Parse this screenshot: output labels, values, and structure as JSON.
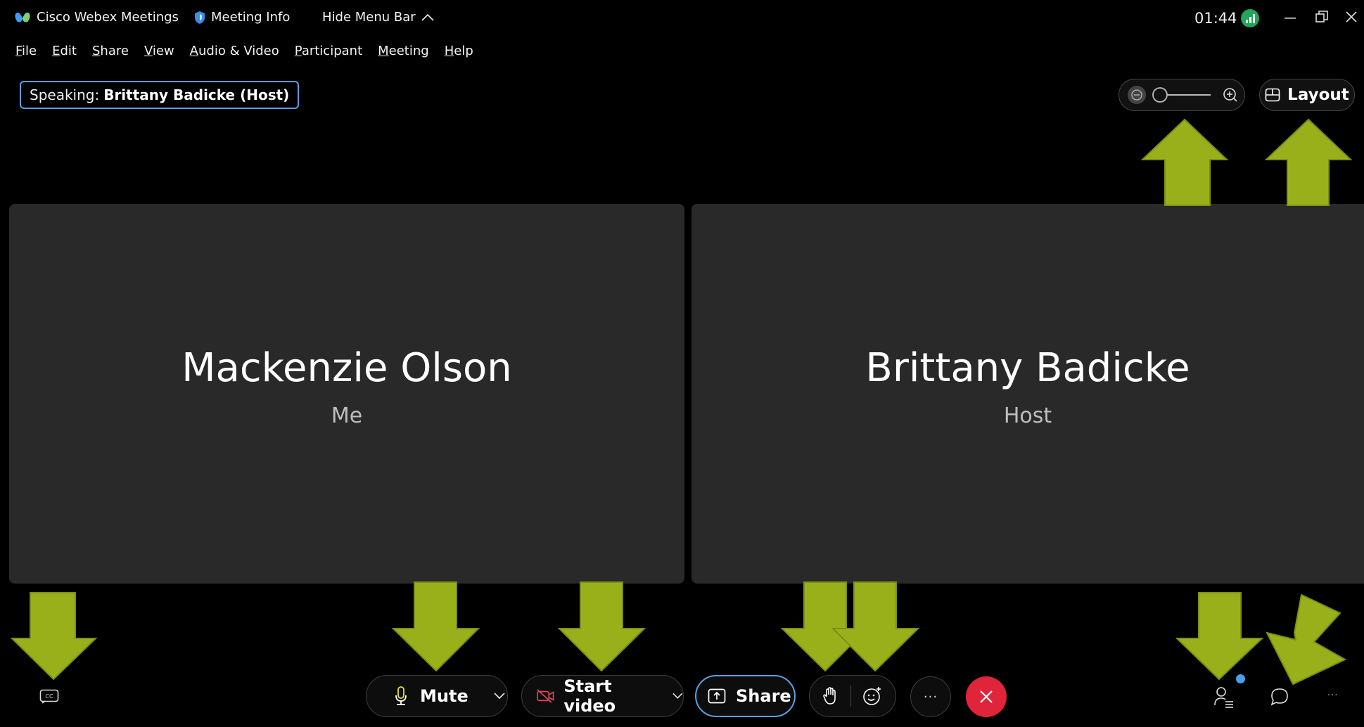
{
  "titlebar": {
    "app_name": "Cisco Webex Meetings",
    "meeting_info": "Meeting Info",
    "hide_menu": "Hide Menu Bar",
    "time": "01:44"
  },
  "menu": {
    "items": [
      "File",
      "Edit",
      "Share",
      "View",
      "Audio & Video",
      "Participant",
      "Meeting",
      "Help"
    ]
  },
  "speaking": {
    "prefix": "Speaking:",
    "name": "Brittany Badicke (Host)"
  },
  "layout_label": "Layout",
  "tiles": [
    {
      "name": "Mackenzie Olson",
      "role": "Me"
    },
    {
      "name": "Brittany Badicke",
      "role": "Host"
    }
  ],
  "controls": {
    "mute": "Mute",
    "start_video": "Start video",
    "share": "Share",
    "more": "···"
  },
  "colors": {
    "arrow": "#9ab01a",
    "end_call": "#e0243a",
    "focus_ring": "#5aa0e0",
    "notification": "#4a9fe8"
  }
}
